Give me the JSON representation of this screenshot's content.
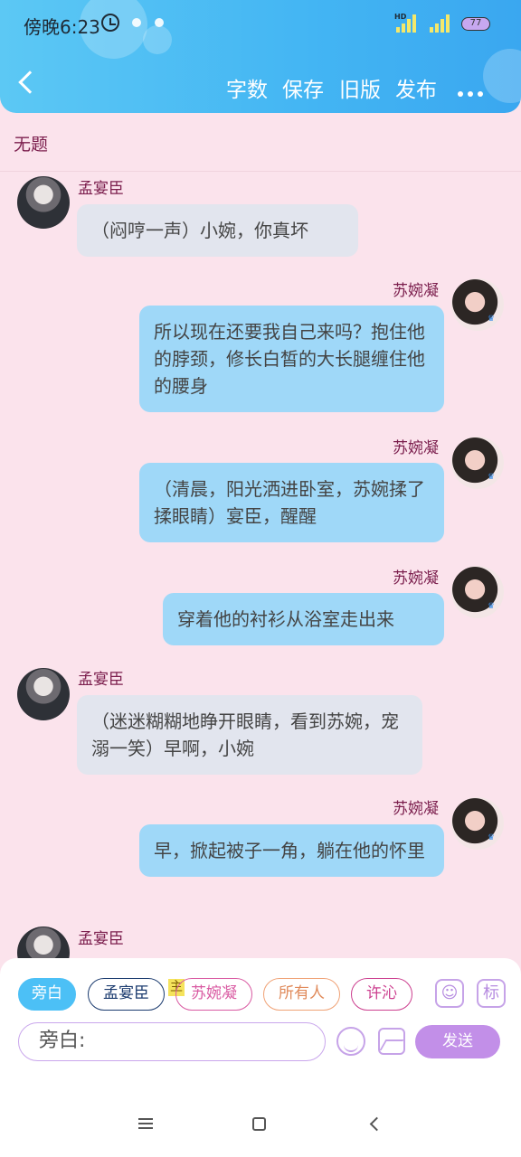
{
  "status_bar": {
    "time": "傍晚6:23",
    "network": "HD",
    "battery": "77"
  },
  "toolbar": {
    "word_count": "字数",
    "save": "保存",
    "old_version": "旧版",
    "publish": "发布"
  },
  "page_title": "无题",
  "messages": [
    {
      "side": "left",
      "speaker": "孟宴臣",
      "text": "（闷哼一声）小婉，你真坏"
    },
    {
      "side": "right",
      "speaker": "苏婉凝",
      "text": "所以现在还要我自己来吗？抱住他的脖颈，修长白皙的大长腿缠住他的腰身"
    },
    {
      "side": "right",
      "speaker": "苏婉凝",
      "text": "（清晨，阳光洒进卧室，苏婉揉了揉眼睛）宴臣，醒醒"
    },
    {
      "side": "right",
      "speaker": "苏婉凝",
      "text": "穿着他的衬衫从浴室走出来"
    },
    {
      "side": "left",
      "speaker": "孟宴臣",
      "text": "（迷迷糊糊地睁开眼睛，看到苏婉，宠溺一笑）早啊，小婉"
    },
    {
      "side": "right",
      "speaker": "苏婉凝",
      "text": "早，掀起被子一角，躺在他的怀里"
    },
    {
      "side": "left",
      "speaker": "孟宴臣",
      "text": ""
    }
  ],
  "role_chips": [
    {
      "label": "旁白",
      "badge": ""
    },
    {
      "label": "孟宴臣",
      "badge": "主"
    },
    {
      "label": "苏婉凝",
      "badge": ""
    },
    {
      "label": "所有人",
      "badge": ""
    },
    {
      "label": "许沁",
      "badge": ""
    }
  ],
  "extra_icons": {
    "role_icon": "person-card-icon",
    "tag_icon": "标"
  },
  "composer": {
    "value": "旁白:",
    "send_label": "发送"
  },
  "colors": {
    "header": "#43b5f3",
    "accent": "#c28fe8",
    "name": "#7b1e4d",
    "right_bubble": "#9fd8f8",
    "left_bubble": "#e2e5ee"
  }
}
